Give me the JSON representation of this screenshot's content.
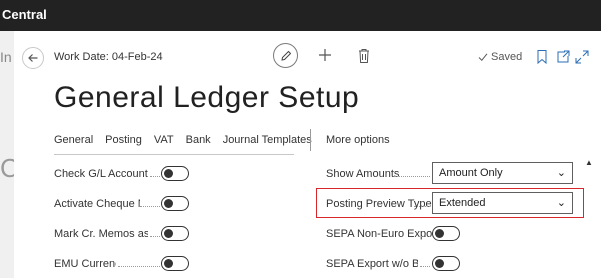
{
  "app": {
    "name": "Central"
  },
  "header": {
    "work_date": "Work Date: 04-Feb-24",
    "saved": "Saved",
    "title": "General Ledger Setup"
  },
  "tabs": [
    {
      "label": "General"
    },
    {
      "label": "Posting"
    },
    {
      "label": "VAT"
    },
    {
      "label": "Bank"
    },
    {
      "label": "Journal Templates"
    }
  ],
  "more_options": "More options",
  "fields_left": [
    {
      "label": "Check G/L Account U...",
      "on": false
    },
    {
      "label": "Activate Cheque No.",
      "on": false
    },
    {
      "label": "Mark Cr. Memos as C...",
      "on": false
    },
    {
      "label": "EMU Currency",
      "on": false
    }
  ],
  "fields_right": {
    "show_amounts": {
      "label": "Show Amounts",
      "value": "Amount Only"
    },
    "posting_preview_type": {
      "label": "Posting Preview Type",
      "value": "Extended"
    },
    "sepa_non_euro": {
      "label": "SEPA Non-Euro Export",
      "on": false
    },
    "sepa_wo_bank": {
      "label": "SEPA Export w/o Ban...",
      "on": false
    }
  },
  "colors": {
    "highlight": "#d9262c",
    "topbar": "#222222"
  },
  "icons": [
    "back-arrow-icon",
    "pencil-icon",
    "plus-icon",
    "trash-icon",
    "checkmark-icon",
    "bookmark-icon",
    "new-window-icon",
    "expand-icon"
  ]
}
